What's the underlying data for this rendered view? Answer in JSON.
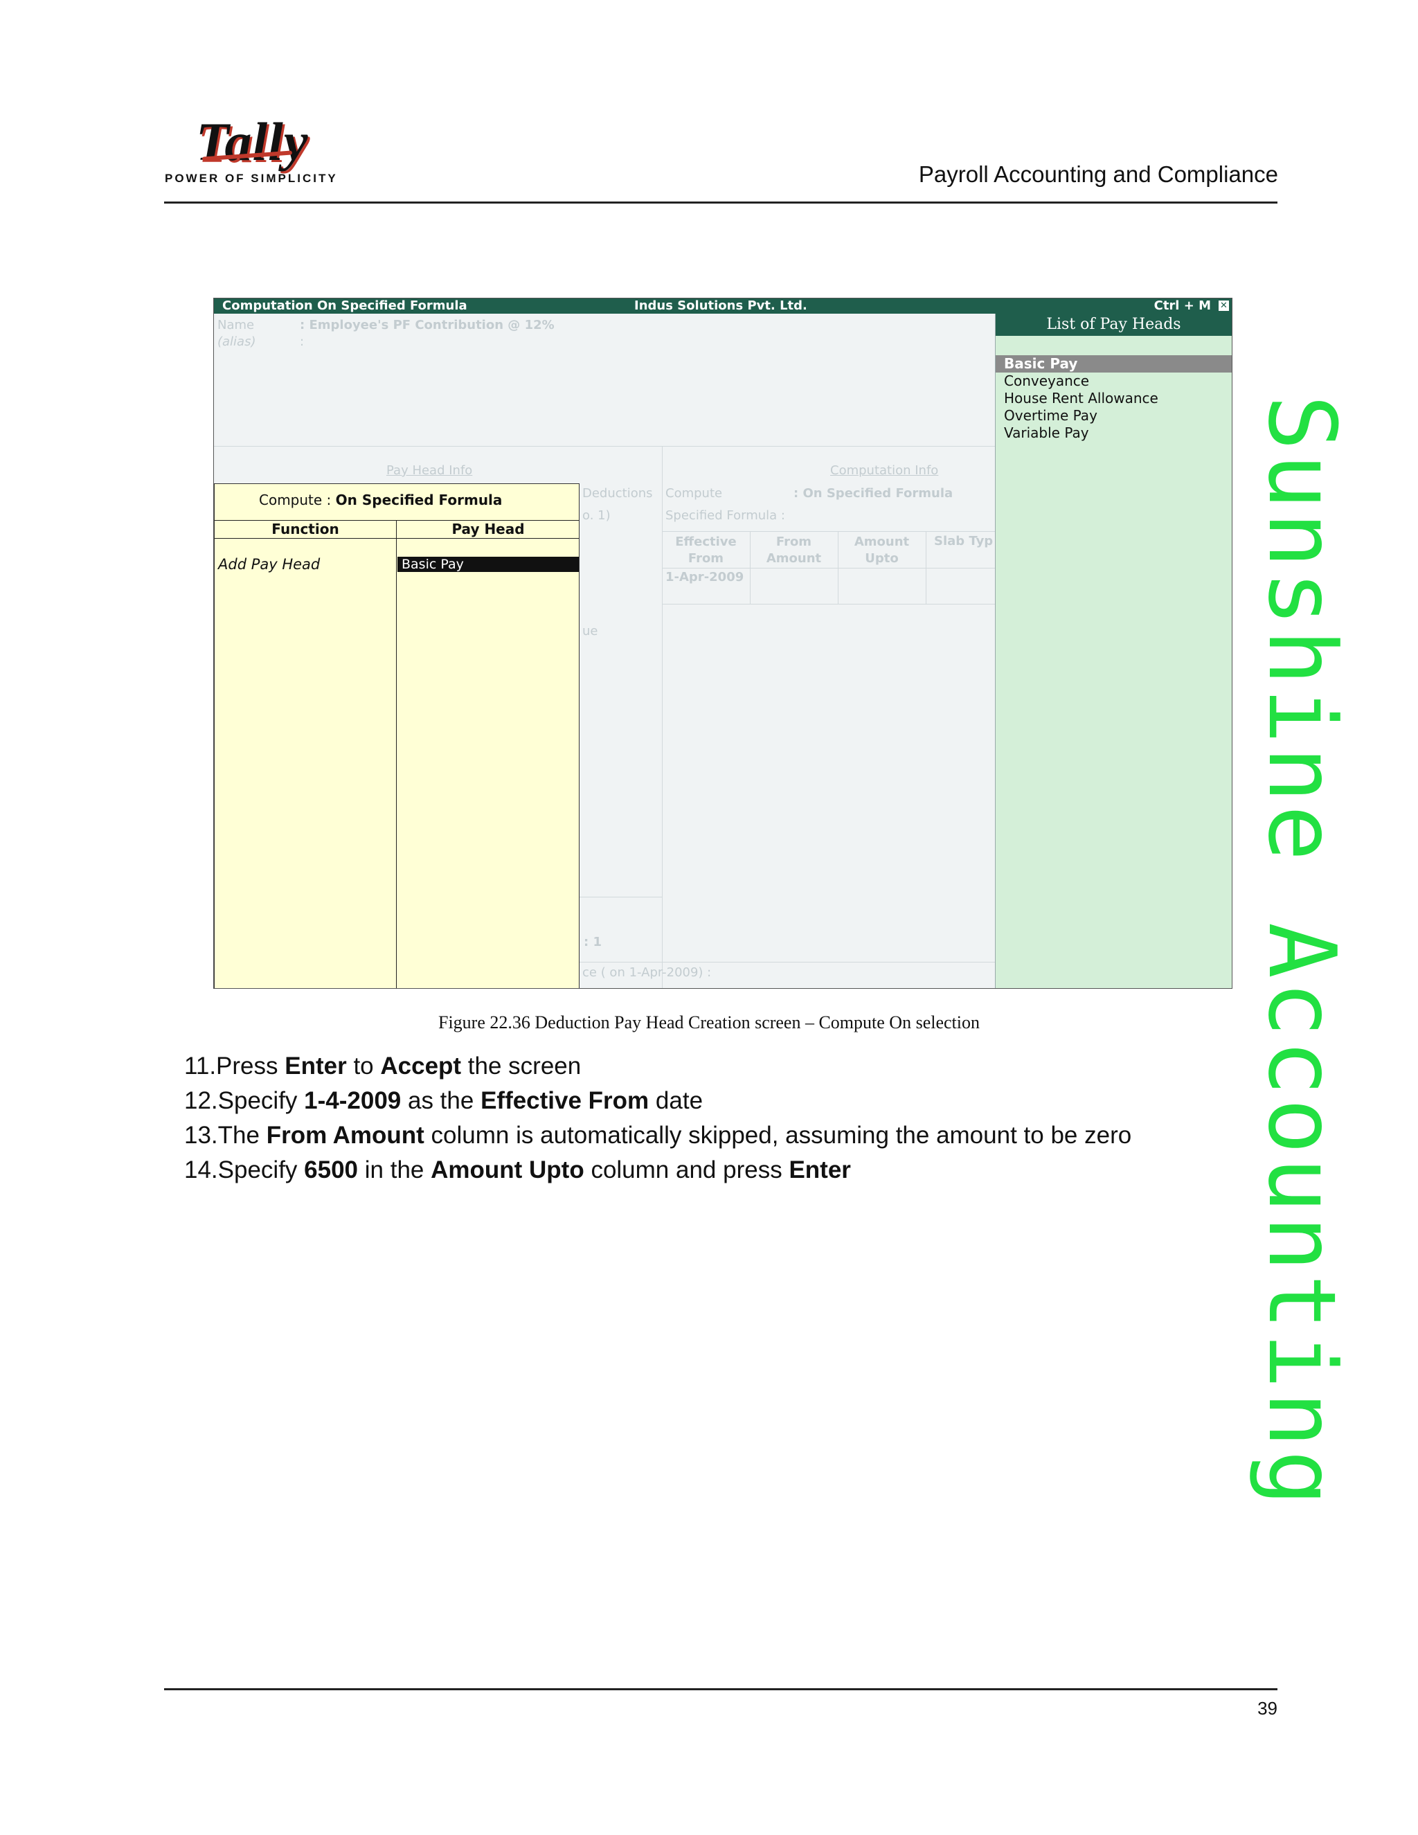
{
  "header": {
    "logo_text": "Tally",
    "tagline": "POWER OF SIMPLICITY",
    "title": "Payroll Accounting and Compliance"
  },
  "screen": {
    "titlebar": {
      "left": "Computation On Specified Formula",
      "center": "Indus Solutions Pvt. Ltd.",
      "right": "Ctrl + M",
      "close_glyph": "✕"
    },
    "background": {
      "name_label": "Name",
      "name_value": ": Employee's PF Contribution @ 12%",
      "alias_label": "(alias)",
      "alias_value": ":",
      "pay_head_info": "Pay Head Info",
      "deductions": "Deductions",
      "paren_one": "o. 1)",
      "ue": "ue",
      "colon_one": ": 1",
      "on_date": "ce    ( on 1-Apr-2009) :",
      "computation_info": "Computation Info",
      "compute_label": "Compute",
      "compute_value": ": On Specified Formula",
      "specified_formula": "Specified Formula  :",
      "cols": [
        "Effective From",
        "From Amount",
        "Amount Upto",
        "Slab Typ"
      ],
      "first_date": "1-Apr-2009"
    },
    "list_panel": {
      "title": "List of Pay Heads",
      "items": [
        "Basic Pay",
        "Conveyance",
        "House Rent Allowance",
        "Overtime Pay",
        "Variable Pay"
      ],
      "selected_index": 0
    },
    "popup": {
      "compute_label": "Compute :",
      "compute_value": "On Specified Formula",
      "col_function": "Function",
      "col_pay_head": "Pay Head",
      "row_function": "Add Pay Head",
      "row_pay_head": "Basic Pay"
    }
  },
  "caption": "Figure 22.36  Deduction Pay Head Creation screen – Compute On selection",
  "steps": [
    {
      "pre": "11.Press ",
      "b1": "Enter",
      "mid": " to ",
      "b2": "Accept",
      "post": " the screen"
    },
    {
      "pre": "12.Specify ",
      "b1": "1-4-2009",
      "mid": " as the ",
      "b2": "Effective From",
      "post": " date"
    },
    {
      "pre": "13.The ",
      "b1": "From Amount",
      "mid": " column is automatically skipped, assuming the amount to be zero",
      "b2": "",
      "post": ""
    },
    {
      "pre": "14.Specify ",
      "b1": "6500",
      "mid": " in the ",
      "b2": "Amount Upto",
      "post": " column and press ",
      "b3": "Enter"
    }
  ],
  "watermark": "Sunshine Accounting",
  "page_number": "39"
}
